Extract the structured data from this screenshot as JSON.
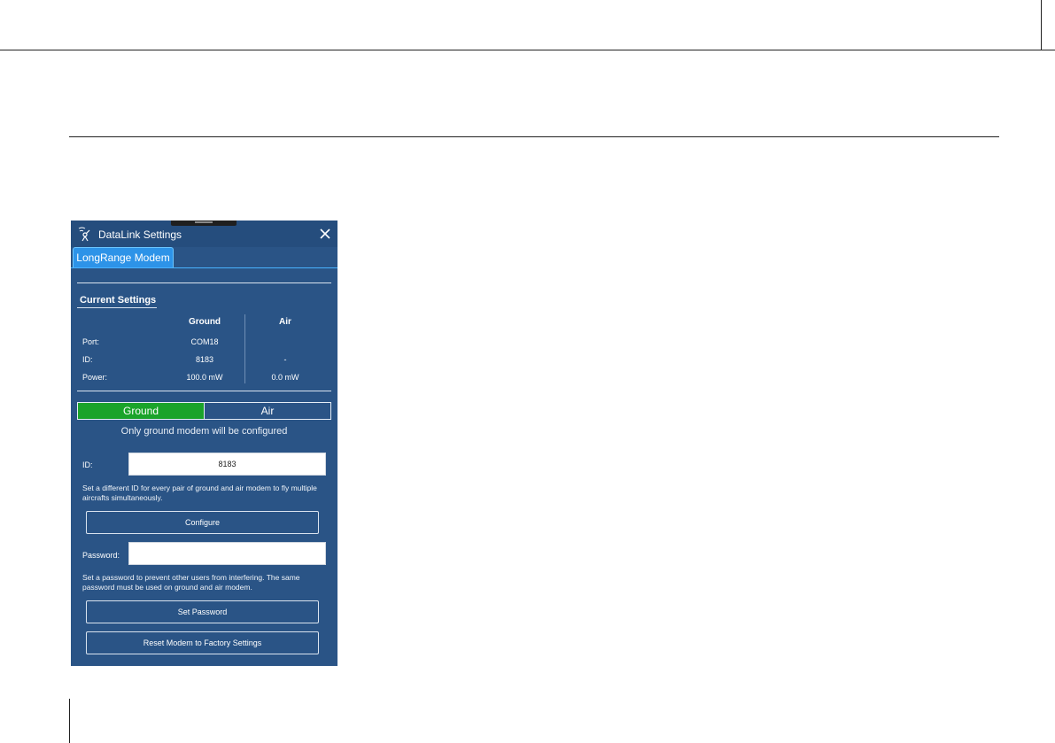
{
  "window": {
    "title": "DataLink Settings",
    "icons": {
      "app": "antenna-icon",
      "close": "close-icon"
    }
  },
  "tabs": [
    {
      "label": "LongRange Modem",
      "active": true
    }
  ],
  "current_settings": {
    "title": "Current Settings",
    "columns": {
      "ground": "Ground",
      "air": "Air"
    },
    "rows": [
      {
        "label": "Port:",
        "ground": "COM18",
        "air": ""
      },
      {
        "label": "ID:",
        "ground": "8183",
        "air": "-"
      },
      {
        "label": "Power:",
        "ground": "100.0 mW",
        "air": "0.0 mW"
      }
    ]
  },
  "mode_toggle": {
    "options": [
      "Ground",
      "Air"
    ],
    "selected": "Ground",
    "note": "Only ground modem will be configured"
  },
  "id_field": {
    "label": "ID:",
    "value": "8183",
    "help": "Set a different ID for every pair of ground and air modem to fly multiple aircrafts simultaneously."
  },
  "configure_button": "Configure",
  "password_field": {
    "label": "Password:",
    "value": "",
    "help": "Set a password to prevent other users from interfering. The same password must be used on ground and air modem."
  },
  "set_password_button": "Set Password",
  "reset_button": "Reset Modem to Factory Settings",
  "colors": {
    "panel_bg": "#2a5486",
    "tab_active": "#2d93e8",
    "toggle_selected": "#1aa32a",
    "text": "#ffffff"
  }
}
